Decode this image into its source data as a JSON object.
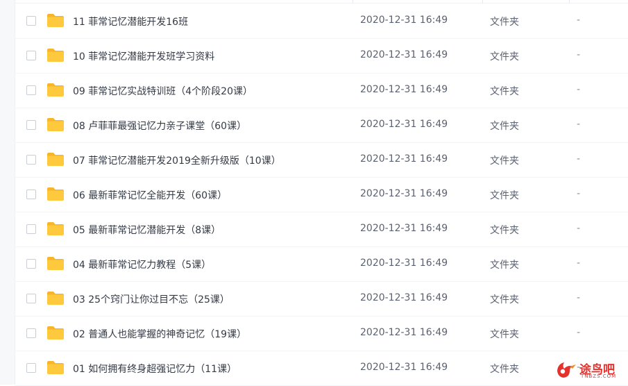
{
  "files": [
    {
      "name": "11 菲常记忆潜能开发16班",
      "modified": "2020-12-31 16:49",
      "type": "文件夹",
      "size": "-"
    },
    {
      "name": "10 菲常记忆潜能开发班学习资料",
      "modified": "2020-12-31 16:49",
      "type": "文件夹",
      "size": "-"
    },
    {
      "name": "09 菲常记忆实战特训班（4个阶段20课）",
      "modified": "2020-12-31 16:49",
      "type": "文件夹",
      "size": "-"
    },
    {
      "name": "08 卢菲菲最强记忆力亲子课堂（60课）",
      "modified": "2020-12-31 16:49",
      "type": "文件夹",
      "size": "-"
    },
    {
      "name": "07 菲常记忆潜能开发2019全新升级版（10课）",
      "modified": "2020-12-31 16:49",
      "type": "文件夹",
      "size": "-"
    },
    {
      "name": "06 最新菲常记忆全能开发（60课）",
      "modified": "2020-12-31 16:49",
      "type": "文件夹",
      "size": "-"
    },
    {
      "name": "05 最新菲常记忆潜能开发（8课）",
      "modified": "2020-12-31 16:49",
      "type": "文件夹",
      "size": "-"
    },
    {
      "name": "04 最新菲常记忆力教程（5课）",
      "modified": "2020-12-31 16:49",
      "type": "文件夹",
      "size": "-"
    },
    {
      "name": "03 25个窍门让你过目不忘（25课）",
      "modified": "2020-12-31 16:49",
      "type": "文件夹",
      "size": "-"
    },
    {
      "name": "02 普通人也能掌握的神奇记忆（19课）",
      "modified": "2020-12-31 16:49",
      "type": "文件夹",
      "size": "-"
    },
    {
      "name": "01 如何拥有终身超强记忆力（11课）",
      "modified": "2020-12-31 16:49",
      "type": "文件夹",
      "size": "-"
    }
  ],
  "icons": {
    "folder": "folder-icon",
    "checkbox": "checkbox-icon"
  },
  "colors": {
    "folder": "#ffc93e",
    "folder_back": "#f7b52c",
    "watermark": "#e3332f"
  },
  "watermark": {
    "text": "途鸟吧",
    "sub": "TNBZS.COM"
  }
}
